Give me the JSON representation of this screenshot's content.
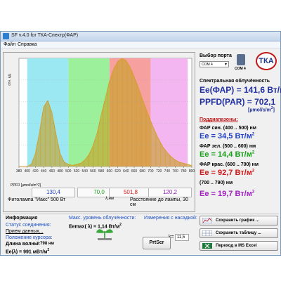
{
  "window": {
    "title": "SF v.4.0 for ТКА-Спектр(ФАР)",
    "menu": [
      "Файл",
      "Справка"
    ]
  },
  "plot": {
    "caption_left": "Фитолампа \"Иакс\" 500 Вт",
    "caption_mid": "λ,нм",
    "caption_right": "Расстояние до лампы, 30 см",
    "ppfd_label": "PPFD [µmol/s/m^2]",
    "ppfd_values": [
      "130,4",
      "70,0",
      "501,8",
      "120,2"
    ]
  },
  "chart_data": {
    "type": "bar",
    "xlim": [
      380,
      800
    ],
    "ylim": [
      0,
      1
    ],
    "ylabel": "отн. ед.",
    "x_ticks": [
      380,
      400,
      420,
      440,
      460,
      480,
      500,
      520,
      540,
      560,
      580,
      600,
      620,
      640,
      660,
      680,
      700,
      720,
      740,
      760,
      780,
      800
    ],
    "bands": [
      {
        "from": 400,
        "to": 500,
        "color": "#9be8f2"
      },
      {
        "from": 500,
        "to": 600,
        "color": "#9cf09c"
      },
      {
        "from": 600,
        "to": 700,
        "color": "#f6a0a0"
      },
      {
        "from": 700,
        "to": 790,
        "color": "#f4b6f0"
      }
    ],
    "curve_points": [
      [
        380,
        0.0
      ],
      [
        400,
        0.0
      ],
      [
        410,
        0.02
      ],
      [
        420,
        0.12
      ],
      [
        430,
        0.32
      ],
      [
        440,
        0.55
      ],
      [
        450,
        0.61
      ],
      [
        460,
        0.5
      ],
      [
        470,
        0.3
      ],
      [
        480,
        0.12
      ],
      [
        490,
        0.04
      ],
      [
        500,
        0.02
      ],
      [
        510,
        0.01
      ],
      [
        520,
        0.02
      ],
      [
        530,
        0.03
      ],
      [
        540,
        0.06
      ],
      [
        550,
        0.11
      ],
      [
        560,
        0.19
      ],
      [
        570,
        0.31
      ],
      [
        580,
        0.48
      ],
      [
        590,
        0.63
      ],
      [
        600,
        0.79
      ],
      [
        610,
        0.9
      ],
      [
        620,
        0.97
      ],
      [
        630,
        1.0
      ],
      [
        640,
        0.98
      ],
      [
        650,
        0.92
      ],
      [
        660,
        0.83
      ],
      [
        670,
        0.73
      ],
      [
        680,
        0.62
      ],
      [
        690,
        0.52
      ],
      [
        700,
        0.42
      ],
      [
        710,
        0.33
      ],
      [
        720,
        0.25
      ],
      [
        730,
        0.18
      ],
      [
        740,
        0.13
      ],
      [
        750,
        0.09
      ],
      [
        760,
        0.06
      ],
      [
        770,
        0.04
      ],
      [
        780,
        0.03
      ],
      [
        790,
        0.02
      ],
      [
        800,
        0.01
      ]
    ],
    "bar_color": "#c8a024",
    "line_color": "#d89a20"
  },
  "right": {
    "port_label": "Выбор порта",
    "port_value": "COM 4",
    "device_label": "COM 4",
    "logo_text": "ТКА",
    "spec_title": "Спектральная облучённость",
    "ee_fap": "Ee(ФАР) = 141,6 Вт/м",
    "ppfd_par": "PPFD(PAR) = 702,1",
    "ppfd_unit": "[µmol/s/m",
    "subranges_title": "Поддиапазоны:",
    "bands": [
      {
        "label": "ФАР син. (400 .. 500) нм",
        "value": "Ee = 34,5 Вт/м",
        "color": "#1f3fc4"
      },
      {
        "label": "ФАР зел. (500 .. 600) нм",
        "value": "Ee = 14,4 Вт/м",
        "color": "#18a018"
      },
      {
        "label": "ФАР крас. (600 .. 700) нм",
        "value": "Ee = 92,7 Вт/м",
        "color": "#d01818"
      },
      {
        "label": "(700 .. 790) нм",
        "value": "Ee = 19,7 Вт/м",
        "color": "#a020c0"
      }
    ]
  },
  "info": {
    "title": "Информация",
    "status_label": "Статус соединения:",
    "status_link": "Прием данных...",
    "cursor_label": "Положение курсора:",
    "wavelength": "Длина волны:",
    "wavelength_val": "= 798 нм",
    "ee_lambda": "Ee(λ) = 991 мВт/м",
    "max_label": "Макс. уровень облучённости:",
    "emax": "Eemax( λ) = 1,14 Вт/м",
    "measure_label": "Измерения с насадкой:",
    "k_label": "k=",
    "k_value": "11,5",
    "prtscr": "PrtScr",
    "btn_graph": "Сохранить график ...",
    "btn_table": "Сохранить таблицу ...",
    "btn_excel": "Переход в MS Excel"
  }
}
